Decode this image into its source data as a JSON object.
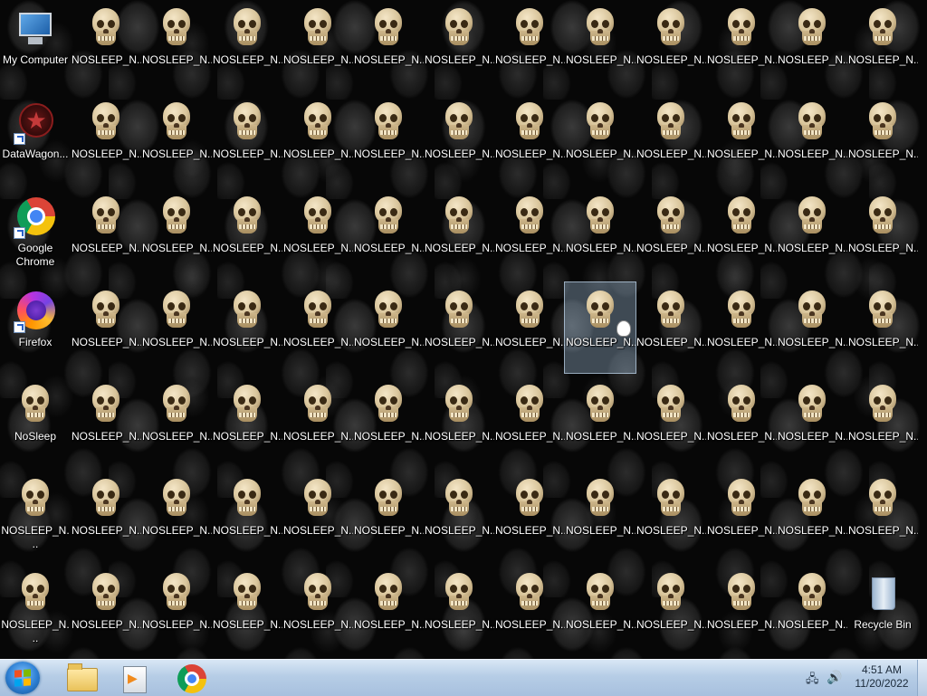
{
  "desktop": {
    "icons": [
      {
        "label": "My Computer",
        "type": "computer",
        "shortcut": false,
        "col": 0,
        "row": 0
      },
      {
        "label": "DataWagon...",
        "type": "datawagon",
        "shortcut": true,
        "col": 0,
        "row": 1
      },
      {
        "label": "Google Chrome",
        "type": "chrome",
        "shortcut": true,
        "col": 0,
        "row": 2
      },
      {
        "label": "Firefox",
        "type": "firefox",
        "shortcut": true,
        "col": 0,
        "row": 3
      },
      {
        "label": "NoSleep",
        "type": "skull",
        "shortcut": false,
        "col": 0,
        "row": 4
      },
      {
        "label": "NOSLEEP_N...",
        "type": "skull",
        "shortcut": false,
        "col": 0,
        "row": 5
      },
      {
        "label": "NOSLEEP_N...",
        "type": "skull",
        "shortcut": false,
        "col": 0,
        "row": 6
      },
      {
        "label": "Recycle Bin",
        "type": "recyclebin",
        "shortcut": false,
        "col": 12,
        "row": 6
      }
    ],
    "grid_skull_label": "NOSLEEP_N...",
    "selected_icon": {
      "col": 8,
      "row": 3,
      "label": "NOSLEEP_N..."
    }
  },
  "taskbar": {
    "start_label": "Start",
    "pinned": [
      {
        "name": "windows-explorer",
        "icon": "folder-icon"
      },
      {
        "name": "windows-media-player",
        "icon": "media-player-icon"
      },
      {
        "name": "google-chrome",
        "icon": "chrome-icon"
      }
    ],
    "clock": {
      "time": "4:51 AM",
      "date": "11/20/2022"
    }
  }
}
